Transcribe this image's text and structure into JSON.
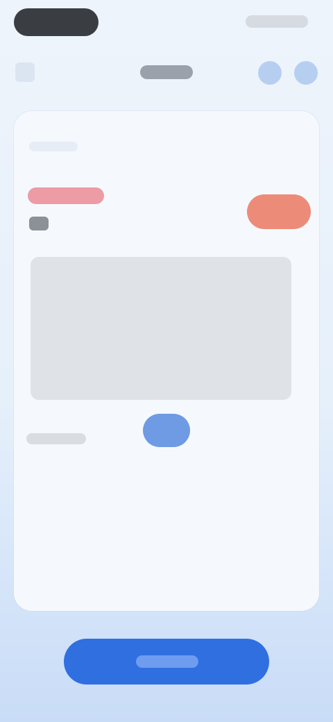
{
  "status_bar": {},
  "nav": {},
  "card": {},
  "footer": {},
  "colors": {
    "primary": "#2f6fe0",
    "accent": "#ec8c78",
    "title_red": "#ed9ba4",
    "chip": "#6e9be3"
  },
  "icons": {
    "back": "chevron-left-icon",
    "share": "share-icon",
    "more": "more-icon"
  }
}
